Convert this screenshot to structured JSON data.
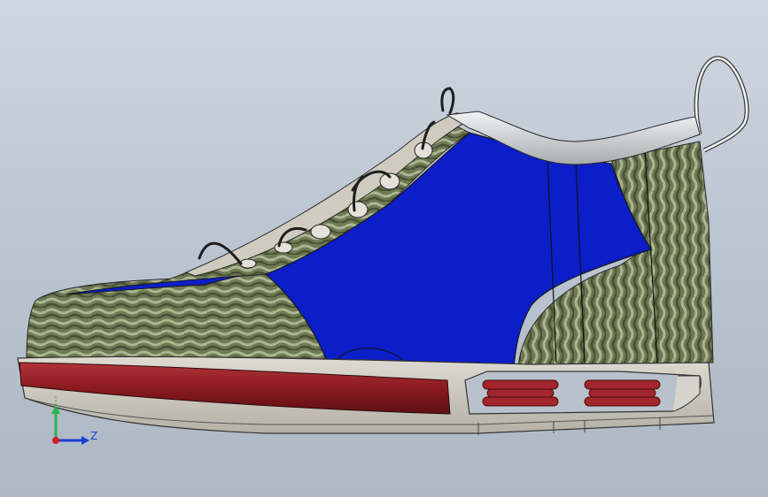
{
  "triad": {
    "z_label": "Z",
    "y_axis_color": "#2bb34a",
    "z_axis_color": "#1d3fd8",
    "x_axis_color": "#d02020"
  },
  "colors": {
    "upper_blue": "#0c1ec8",
    "mesh_green": "#6f7a52",
    "sole_grey": "#c9c6bd",
    "stripe_red": "#8c1a1f",
    "spring_red": "#a3262c",
    "collar_silver": "#d9dadc",
    "lace_black": "#1e1e1e"
  }
}
